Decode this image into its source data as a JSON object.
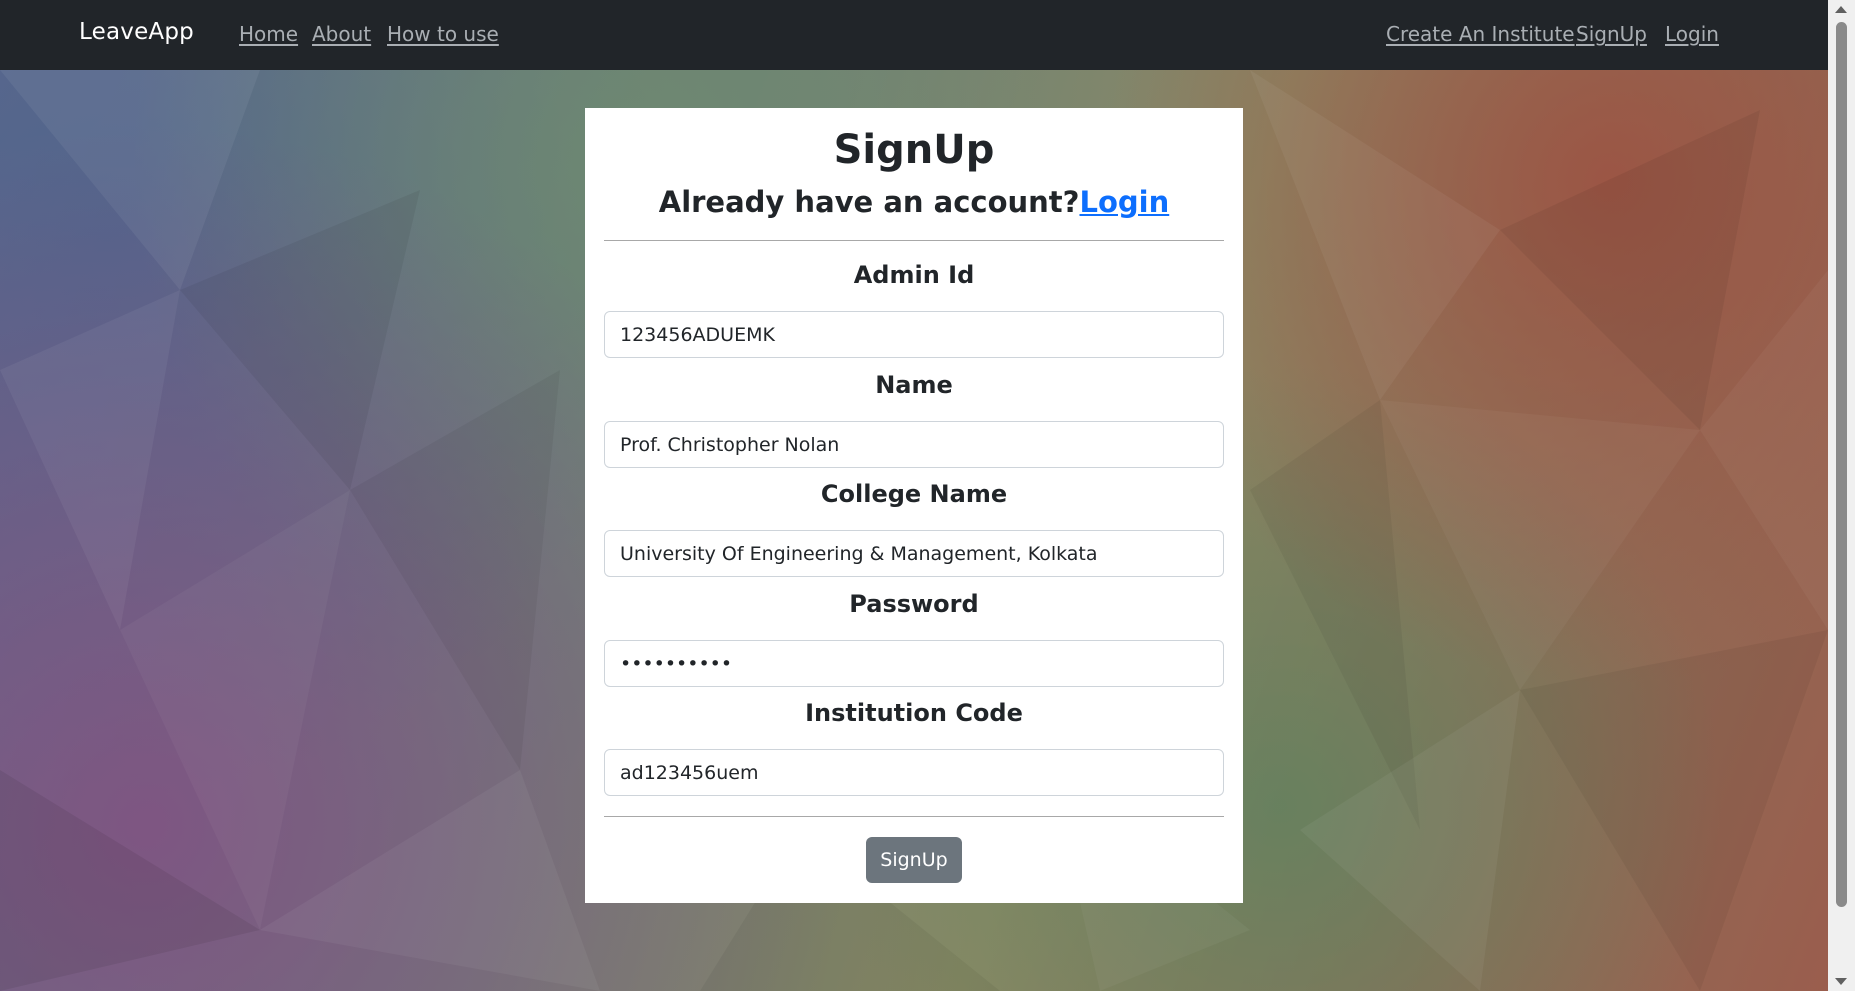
{
  "navbar": {
    "brand": "LeaveApp",
    "left_links": [
      "Home",
      "About",
      "How to use"
    ],
    "right_links": [
      "Create An Institute",
      "SignUp",
      "Login"
    ]
  },
  "form": {
    "title": "SignUp",
    "subtitle_text": "Already have an account?",
    "subtitle_link": "Login",
    "fields": [
      {
        "label": "Admin Id",
        "value": "123456ADUEMK"
      },
      {
        "label": "Name",
        "value": "Prof. Christopher Nolan"
      },
      {
        "label": "College Name",
        "value": "University Of Engineering & Management, Kolkata"
      },
      {
        "label": "Password",
        "value": "••••••••••"
      },
      {
        "label": "Institution Code",
        "value": "ad123456uem"
      }
    ],
    "submit_label": "SignUp"
  },
  "colors": {
    "navbar_bg": "#212529",
    "link_blue": "#0d6efd",
    "button_gray": "#6c757d"
  }
}
